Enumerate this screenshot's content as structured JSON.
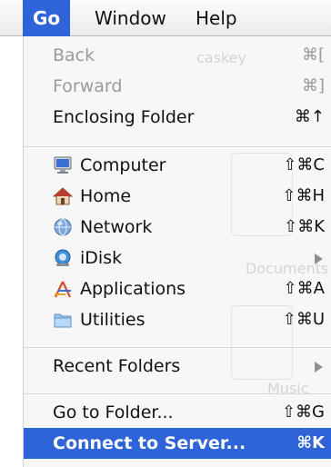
{
  "menubar": {
    "items": [
      {
        "label": "Go",
        "active": true
      },
      {
        "label": "Window",
        "active": false
      },
      {
        "label": "Help",
        "active": false
      }
    ]
  },
  "menu": {
    "back": {
      "label": "Back",
      "shortcut": "⌘["
    },
    "forward": {
      "label": "Forward",
      "shortcut": "⌘]"
    },
    "enclosing_folder": {
      "label": "Enclosing Folder",
      "shortcut": "⌘↑"
    },
    "computer": {
      "label": "Computer",
      "shortcut": "⇧⌘C",
      "icon": "computer-icon"
    },
    "home": {
      "label": "Home",
      "shortcut": "⇧⌘H",
      "icon": "home-icon"
    },
    "network": {
      "label": "Network",
      "shortcut": "⇧⌘K",
      "icon": "network-icon"
    },
    "idisk": {
      "label": "iDisk",
      "icon": "idisk-icon"
    },
    "applications": {
      "label": "Applications",
      "shortcut": "⇧⌘A",
      "icon": "applications-icon"
    },
    "utilities": {
      "label": "Utilities",
      "shortcut": "⇧⌘U",
      "icon": "utilities-folder-icon"
    },
    "recent_folders": {
      "label": "Recent Folders"
    },
    "go_to_folder": {
      "label": "Go to Folder...",
      "shortcut": "⇧⌘G"
    },
    "connect_to_server": {
      "label": "Connect to Server...",
      "shortcut": "⌘K"
    }
  },
  "background": {
    "username": "caskey",
    "documents": "Documents",
    "music": "Music"
  },
  "colors": {
    "highlight": "#2f63d8",
    "menu_background": "#f7f7f7",
    "disabled_text": "#9a9a9a"
  }
}
